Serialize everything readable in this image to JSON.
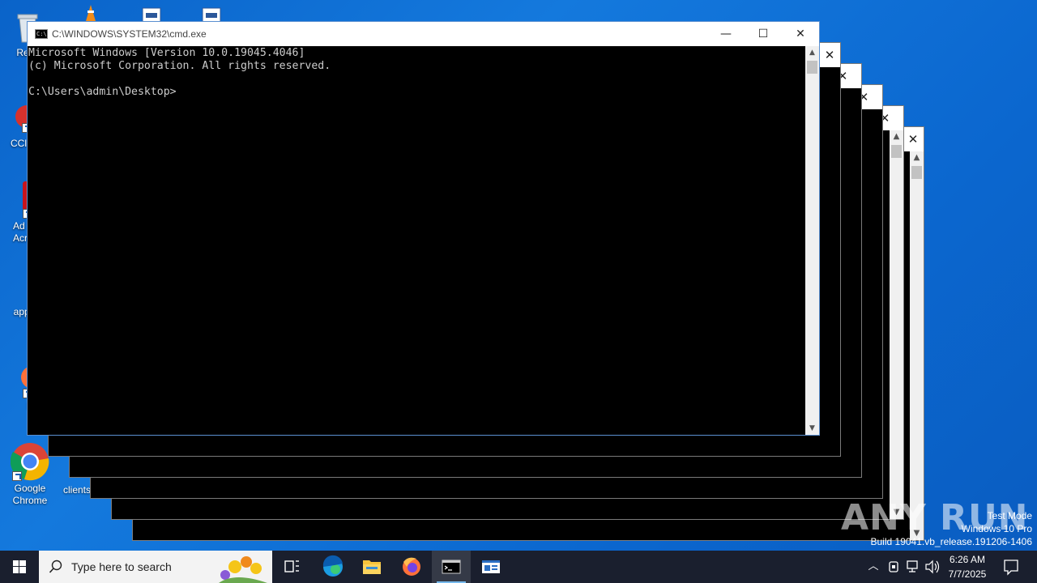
{
  "desktop": {
    "icons": [
      {
        "label": "Recy"
      },
      {
        "label": "CCl"
      },
      {
        "label": "Ad Acr"
      },
      {
        "label": "appro"
      },
      {
        "label": "Fir"
      },
      {
        "label": "Google Chrome"
      },
      {
        "label": "clients"
      }
    ]
  },
  "cmd_window": {
    "title": "C:\\WINDOWS\\SYSTEM32\\cmd.exe",
    "lines": [
      "Microsoft Windows [Version 10.0.19045.4046]",
      "(c) Microsoft Corporation. All rights reserved.",
      "",
      "C:\\Users\\admin\\Desktop>"
    ],
    "text_color": "#cccccc"
  },
  "icons": {
    "minimize": "minimize-icon",
    "maximize": "maximize-icon",
    "close": "close-icon"
  },
  "watermark": {
    "line1": "Test Mode",
    "line2": "Windows 10 Pro",
    "line3": "Build 19041.vb_release.191206-1406",
    "logo": "ANY RUN"
  },
  "taskbar": {
    "search_placeholder": "Type here to search",
    "time": "6:26 AM",
    "date": "7/7/2025"
  },
  "colors": {
    "desktop": "#0a63c9",
    "taskbar": "#1a1f2e",
    "console_bg": "#000000"
  }
}
